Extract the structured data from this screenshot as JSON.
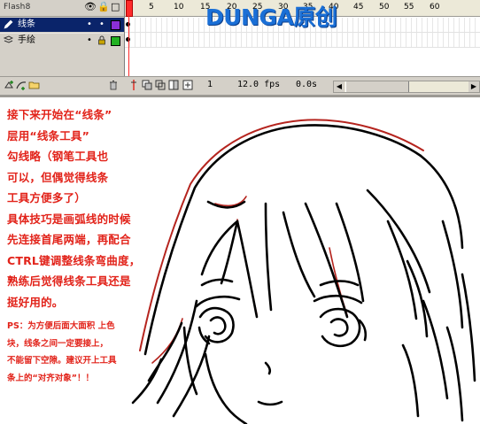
{
  "timeline": {
    "header": {
      "flash_label": "Flash8",
      "eye_icon": "👁",
      "lock_icon": "🔒",
      "outline_icon": "□"
    },
    "layers": [
      {
        "name": "线条",
        "selected": true,
        "color": "#8b2fd6",
        "icon": "pencil-icon"
      },
      {
        "name": "手绘",
        "selected": false,
        "color": "#22b122",
        "icon": "layer-icon"
      }
    ],
    "frame_numbers": [
      "1",
      "5",
      "10",
      "15",
      "20",
      "25",
      "30",
      "35",
      "40",
      "45",
      "50",
      "55",
      "60"
    ],
    "status": {
      "current_frame": "1",
      "frame_rate": "12.0 fps",
      "elapsed": "0.0s"
    }
  },
  "logo": {
    "text": "DUNGA原创",
    "color": "#1a6fd6"
  },
  "tutorial": {
    "lines": [
      "接下来开始在“线条”",
      "层用“线条工具”",
      "勾线略（钢笔工具也",
      "可以，但偶觉得线条",
      "工具方便多了）",
      "具体技巧是画弧线的时候",
      "先连接首尾两端，再配合",
      "CTRL键调整线条弯曲度，",
      "熟练后觉得线条工具还是",
      "挺好用的。"
    ],
    "ps_lines": [
      "PS：为方便后面大面积  上色",
      "块，线条之间一定要接上，",
      "不能留下空隙。建议开上工具",
      "条上的“对齐对象”！！"
    ],
    "color": "#e2231a"
  }
}
